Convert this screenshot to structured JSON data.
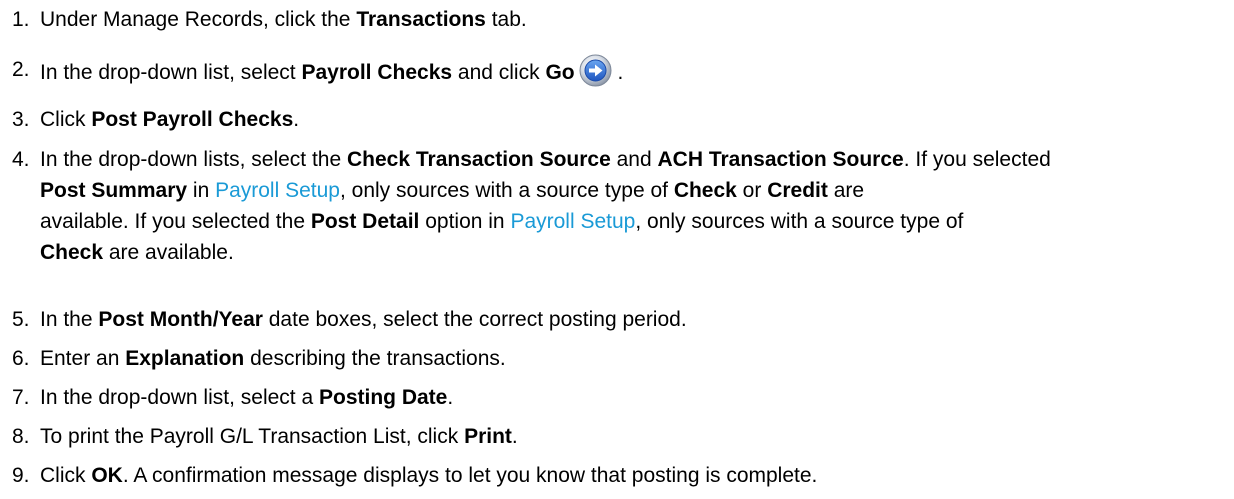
{
  "steps": [
    {
      "number": "1.",
      "parts": [
        "Under Manage Records, click the ",
        "Transactions",
        " tab."
      ]
    },
    {
      "number": "2.",
      "parts": [
        "In the drop-down list, select ",
        "Payroll Checks",
        " and click ",
        "Go",
        " ."
      ],
      "icon": "go-arrow-icon"
    },
    {
      "number": "3.",
      "parts": [
        "Click ",
        "Post Payroll Checks",
        "."
      ]
    },
    {
      "number": "4.",
      "parts": [
        "In the drop-down lists, select the ",
        "Check Transaction Source",
        " and ",
        "ACH Transaction Source",
        ". If you selected ",
        "Post Summary",
        " in ",
        "Payroll Setup",
        ", only sources with a source type of ",
        "Check",
        " or ",
        "Credit",
        " are available. If you selected the ",
        "Post Detail",
        " option in ",
        "Payroll Setup",
        ", only sources with a source type of ",
        "Check",
        " are available."
      ]
    },
    {
      "number": "5.",
      "parts": [
        "In the ",
        "Post Month/Year",
        " date boxes, select the correct posting period."
      ]
    },
    {
      "number": "6.",
      "parts": [
        "Enter an ",
        "Explanation",
        " describing the transactions."
      ]
    },
    {
      "number": "7.",
      "parts": [
        "In the drop-down list, select a ",
        "Posting Date",
        "."
      ]
    },
    {
      "number": "8.",
      "parts": [
        "To print the Payroll G/L Transaction List, click ",
        "Print",
        "."
      ]
    },
    {
      "number": "9.",
      "parts": [
        "Click ",
        "OK",
        ". A confirmation message displays to let you know that posting is complete."
      ]
    }
  ],
  "colors": {
    "text": "#000000",
    "link": "#1a9ad6",
    "icon_blue": "#2f6fd0"
  }
}
